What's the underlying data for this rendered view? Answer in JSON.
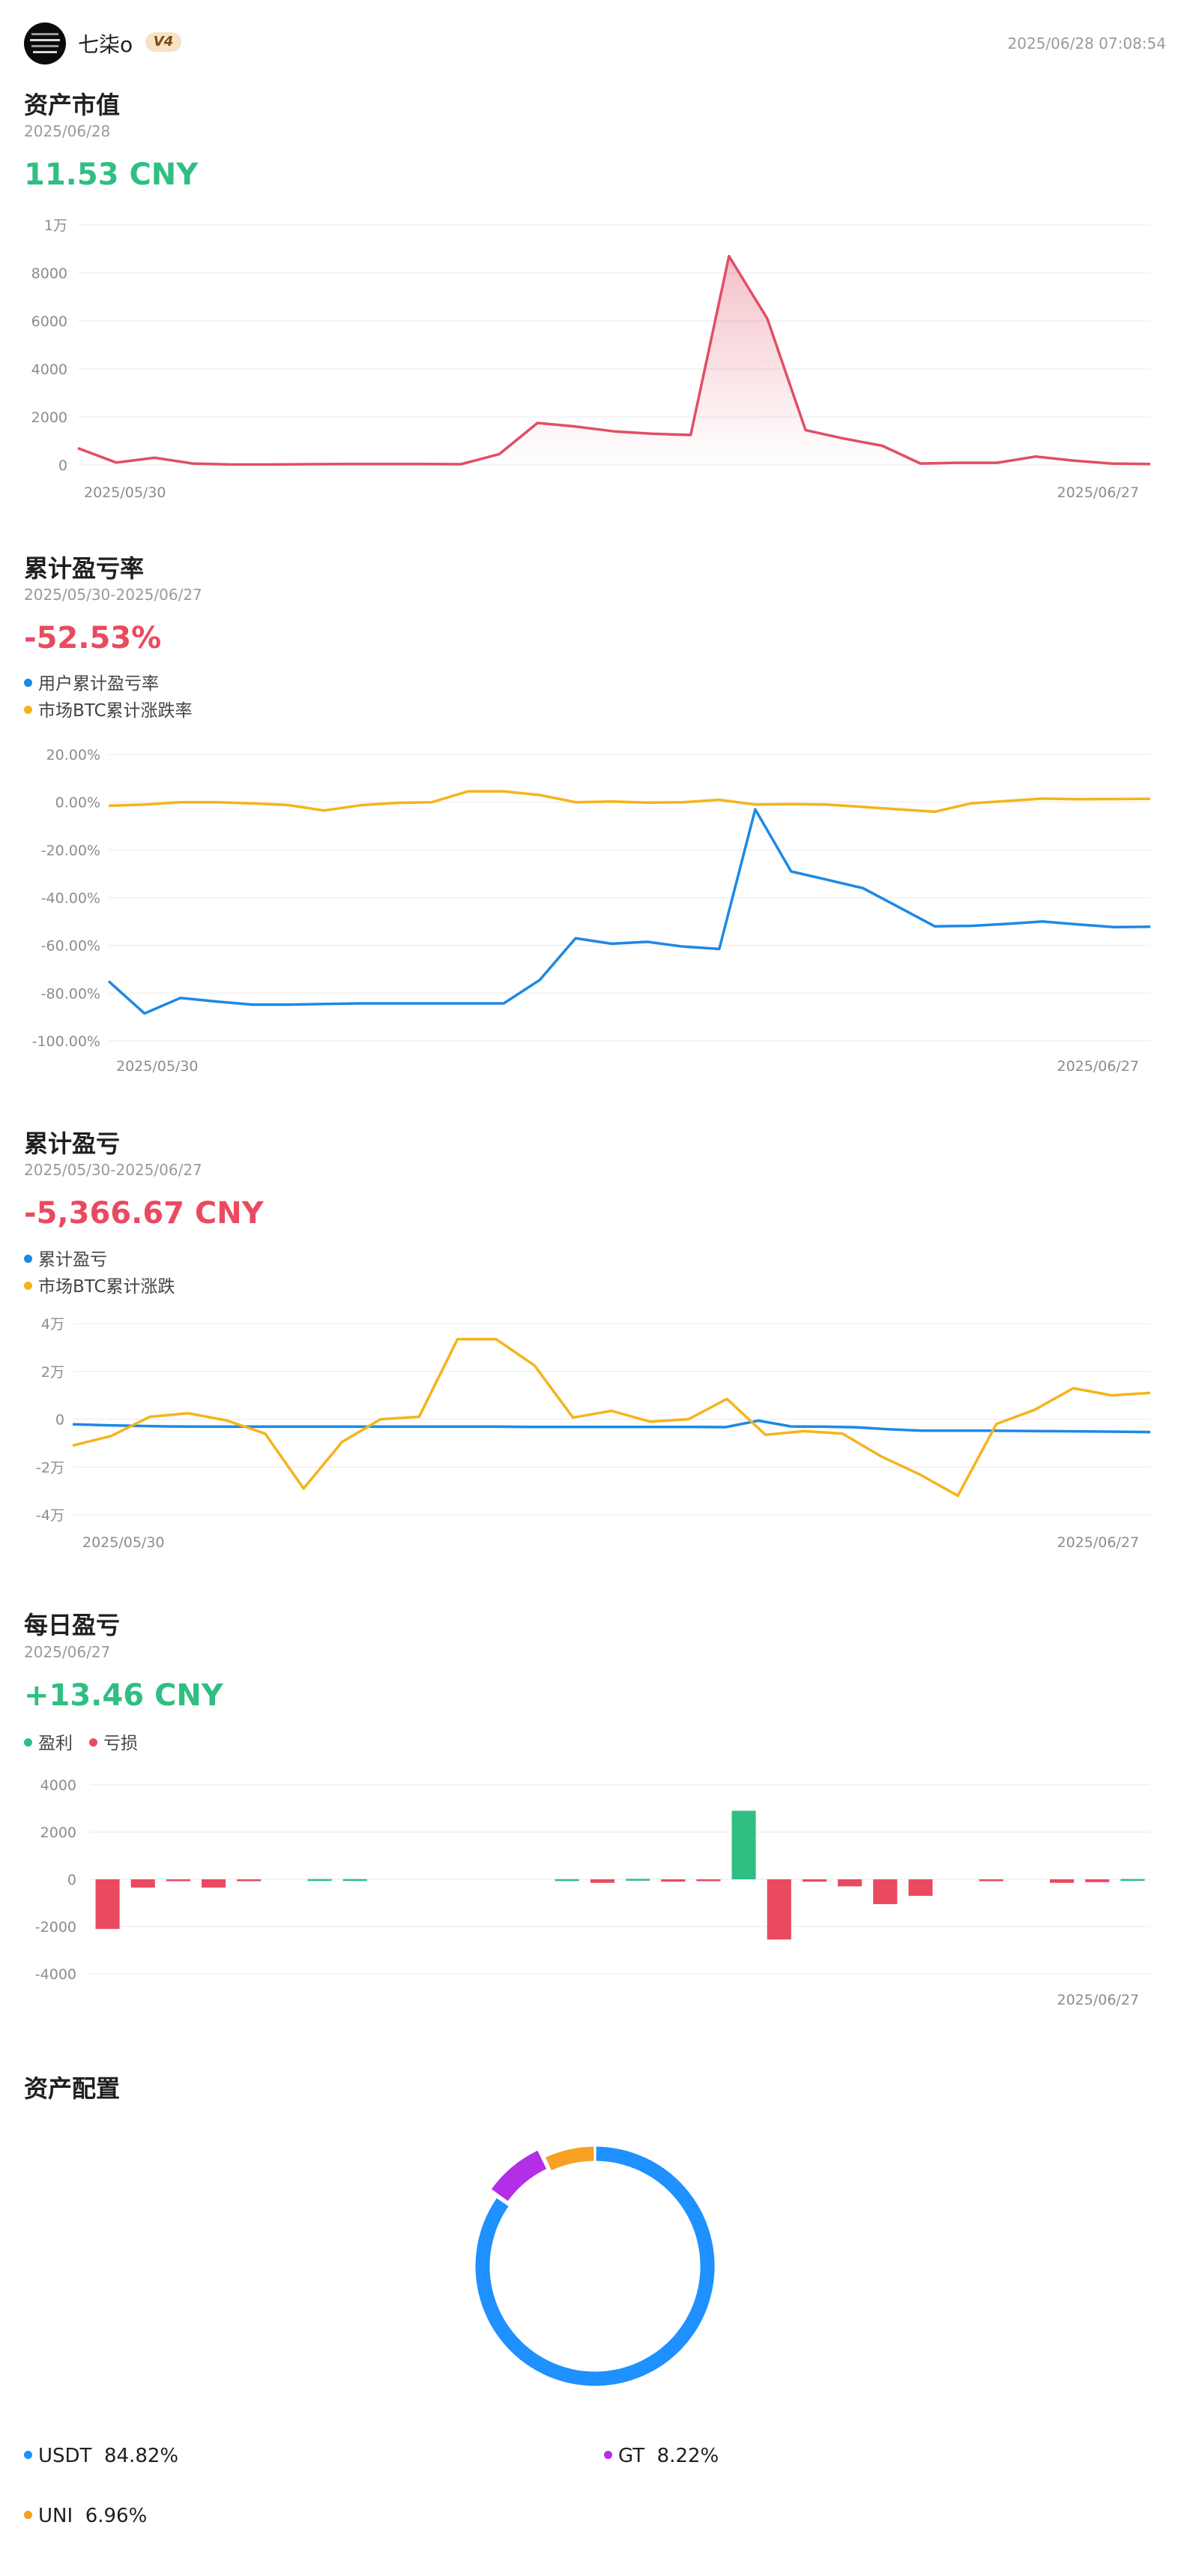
{
  "header": {
    "username": "七柒o",
    "vip_badge": "V4",
    "timestamp": "2025/06/28 07:08:54"
  },
  "asset_value": {
    "title": "资产市值",
    "date": "2025/06/28",
    "value": "11.53 CNY",
    "color": "#e14e63",
    "chart_data": {
      "type": "area",
      "y_ticks": [
        "1万",
        "8000",
        "6000",
        "4000",
        "2000",
        "0"
      ],
      "ylim": [
        0,
        10000
      ],
      "x_labels": [
        "2025/05/30",
        "2025/06/27"
      ],
      "values": [
        700,
        100,
        300,
        60,
        20,
        20,
        30,
        40,
        40,
        40,
        30,
        450,
        1750,
        1600,
        1400,
        1300,
        1250,
        8700,
        6100,
        1450,
        1100,
        800,
        60,
        90,
        90,
        350,
        180,
        60,
        40
      ]
    }
  },
  "cum_rate": {
    "title": "累计盈亏率",
    "date": "2025/05/30-2025/06/27",
    "value": "-52.53%",
    "legend": [
      {
        "label": "用户累计盈亏率",
        "color": "#1e88e5"
      },
      {
        "label": "市场BTC累计涨跌率",
        "color": "#f5b41c"
      }
    ],
    "chart_data": {
      "type": "line",
      "y_ticks": [
        "20.00%",
        "0.00%",
        "-20.00%",
        "-40.00%",
        "-60.00%",
        "-80.00%",
        "-100.00%"
      ],
      "ylim": [
        -100,
        20
      ],
      "x_labels": [
        "2025/05/30",
        "2025/06/27"
      ],
      "series": [
        {
          "name": "用户累计盈亏率",
          "values": [
            -75,
            -88.5,
            -82,
            -83.5,
            -84.8,
            -84.8,
            -84.5,
            -84.3,
            -84.3,
            -84.3,
            -84.3,
            -84.3,
            -74.5,
            -57,
            -59.3,
            -58.5,
            -60.5,
            -61.5,
            -3,
            -29,
            -32.5,
            -36,
            -44,
            -52,
            -51.8,
            -51,
            -50,
            -51.2,
            -52.3,
            -52.2
          ]
        },
        {
          "name": "市场BTC累计涨跌率",
          "values": [
            -1.5,
            -1,
            0,
            0,
            -0.5,
            -1.2,
            -3.5,
            -1.3,
            -0.3,
            0,
            4.5,
            4.5,
            3,
            0,
            0.3,
            -0.2,
            0,
            1,
            -1,
            -0.8,
            -1,
            -2,
            -3,
            -4,
            -0.5,
            0.5,
            1.5,
            1.2,
            1.3,
            1.4
          ]
        }
      ]
    }
  },
  "cum_pnl": {
    "title": "累计盈亏",
    "date": "2025/05/30-2025/06/27",
    "value": "-5,366.67 CNY",
    "legend": [
      {
        "label": "累计盈亏",
        "color": "#1e88e5"
      },
      {
        "label": "市场BTC累计涨跌",
        "color": "#f5b41c"
      }
    ],
    "chart_data": {
      "type": "line",
      "y_ticks": [
        "4万",
        "2万",
        "0",
        "-2万",
        "-4万"
      ],
      "ylim": [
        -40000,
        40000
      ],
      "x_labels": [
        "2025/05/30",
        "2025/06/27"
      ],
      "series": [
        {
          "name": "累计盈亏",
          "values": [
            -2100,
            -2500,
            -2800,
            -3000,
            -3100,
            -3100,
            -3100,
            -3100,
            -3100,
            -3100,
            -3100,
            -3100,
            -3100,
            -3100,
            -3200,
            -3200,
            -3200,
            -3200,
            -3200,
            -3200,
            -3300,
            -600,
            -3000,
            -3100,
            -3400,
            -4200,
            -4800,
            -4800,
            -4800,
            -4900,
            -5000,
            -5100,
            -5200,
            -5366
          ]
        },
        {
          "name": "市场BTC累计涨跌",
          "values": [
            -11000,
            -7000,
            1000,
            2500,
            -500,
            -6000,
            -29000,
            -9500,
            0,
            1000,
            33500,
            33500,
            22500,
            700,
            3500,
            -1000,
            0,
            8500,
            -6500,
            -5000,
            -6000,
            -15500,
            -23000,
            -32000,
            -2000,
            4000,
            13000,
            10000,
            11000
          ]
        }
      ]
    }
  },
  "daily_pnl": {
    "title": "每日盈亏",
    "date": "2025/06/27",
    "value": "+13.46 CNY",
    "legend": [
      {
        "label": "盈利",
        "color": "#2fbf82"
      },
      {
        "label": "亏损",
        "color": "#ea4a5f"
      }
    ],
    "chart_data": {
      "type": "bar",
      "y_ticks": [
        "4000",
        "2000",
        "0",
        "-2000",
        "-4000"
      ],
      "ylim": [
        -4000,
        4000
      ],
      "x_labels": [
        "2025/06/27"
      ],
      "values": [
        -2100,
        -350,
        -80,
        -350,
        -50,
        0,
        10,
        10,
        0,
        0,
        0,
        0,
        0,
        5,
        -150,
        20,
        -100,
        -80,
        2900,
        -2550,
        -100,
        -300,
        -1050,
        -700,
        0,
        -40,
        0,
        -150,
        -120,
        13
      ]
    }
  },
  "allocation": {
    "title": "资产配置",
    "chart_data": {
      "type": "pie",
      "slices": [
        {
          "name": "USDT",
          "percent_label": "84.82%",
          "value": 84.82,
          "color": "#1e90ff"
        },
        {
          "name": "GT",
          "percent_label": "8.22%",
          "value": 8.22,
          "color": "#b42ee8"
        },
        {
          "name": "UNI",
          "percent_label": "6.96%",
          "value": 6.96,
          "color": "#f7a021"
        }
      ]
    }
  }
}
